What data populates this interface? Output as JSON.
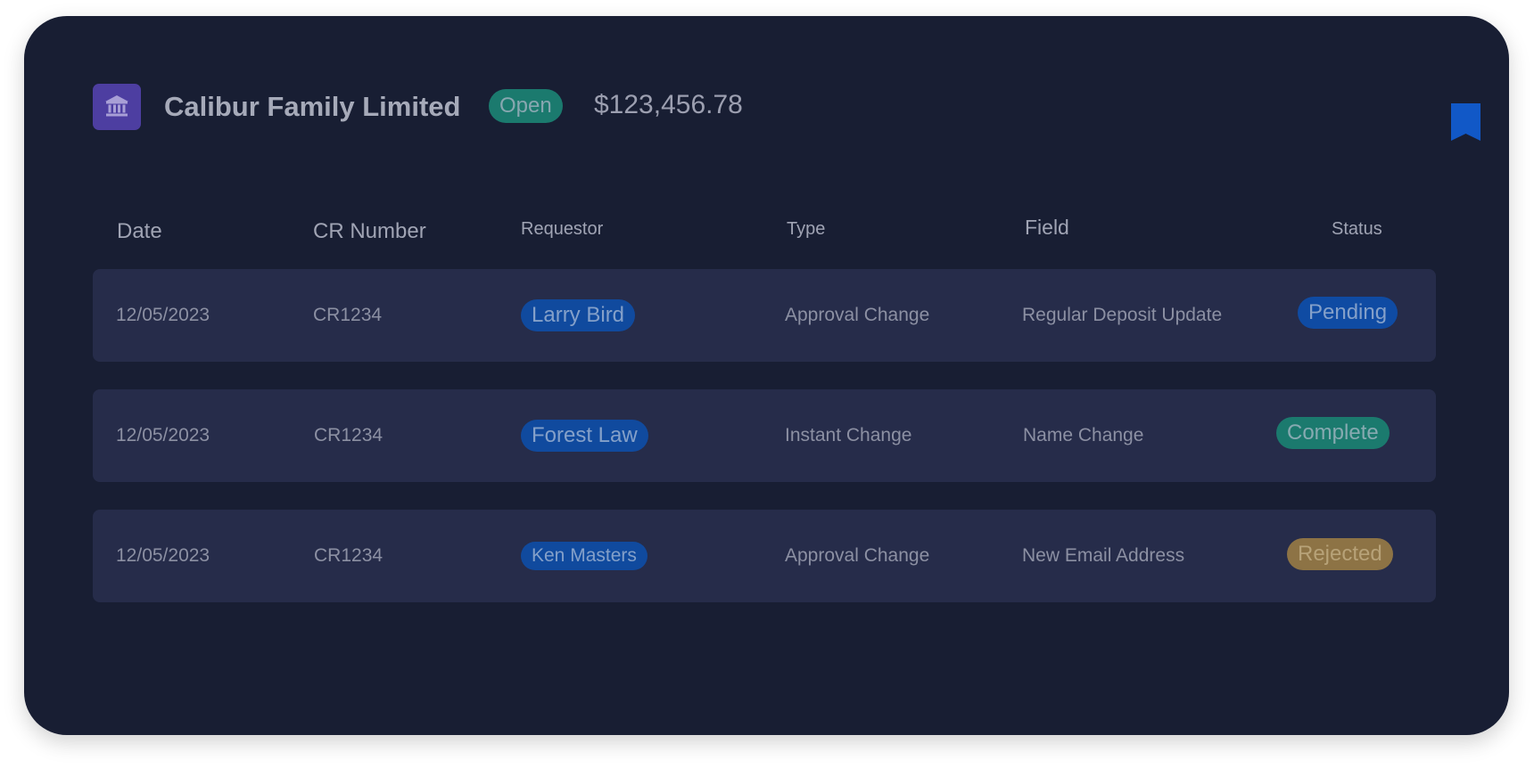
{
  "header": {
    "bank_icon": "bank-icon",
    "title": "Calibur Family Limited",
    "status": "Open",
    "amount": "$123,456.78",
    "bookmark_icon": "bookmark-icon"
  },
  "table": {
    "columns": {
      "date": "Date",
      "cr_number": "CR Number",
      "requestor": "Requestor",
      "type": "Type",
      "field": "Field",
      "status": "Status"
    },
    "rows": [
      {
        "date": "12/05/2023",
        "cr_number": "CR1234",
        "requestor": "Larry Bird",
        "type": "Approval Change",
        "field": "Regular Deposit Update",
        "status": "Pending"
      },
      {
        "date": "12/05/2023",
        "cr_number": "CR1234",
        "requestor": "Forest Law",
        "type": "Instant Change",
        "field": "Name Change",
        "status": "Complete"
      },
      {
        "date": "12/05/2023",
        "cr_number": "CR1234",
        "requestor": "Ken Masters",
        "type": "Approval Change",
        "field": "New Email Address",
        "status": "Rejected"
      }
    ]
  },
  "colors": {
    "card_bg": "#181e33",
    "row_bg": "#262c4a",
    "accent_purple": "#4d3ea1",
    "open_green": "#1b7a6e",
    "pending_blue": "#0f4ba3",
    "complete_green": "#1b7a6e",
    "rejected_amber": "#8d7345",
    "bookmark_blue": "#1158c7"
  }
}
